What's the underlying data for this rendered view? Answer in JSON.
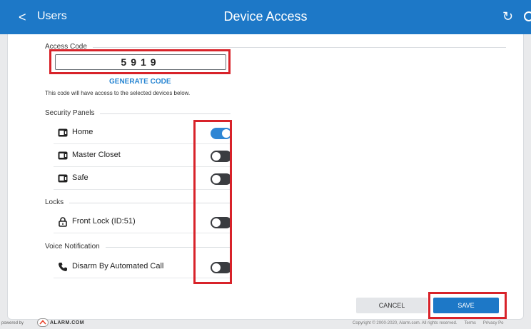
{
  "header": {
    "back_glyph": "<",
    "back_label": "Users",
    "title": "Device Access",
    "refresh_icon": "refresh-icon"
  },
  "access_code": {
    "section_label": "Access Code",
    "value": "5919",
    "generate_label": "GENERATE CODE",
    "help_text": "This code will have access to the selected devices below."
  },
  "security_panels": {
    "section_label": "Security Panels",
    "items": [
      {
        "label": "Home",
        "enabled": true
      },
      {
        "label": "Master Closet",
        "enabled": false
      },
      {
        "label": "Safe",
        "enabled": false
      }
    ]
  },
  "locks": {
    "section_label": "Locks",
    "items": [
      {
        "label": "Front Lock (ID:51)",
        "enabled": false
      }
    ]
  },
  "voice_notification": {
    "section_label": "Voice Notification",
    "items": [
      {
        "label": "Disarm By Automated Call",
        "enabled": false
      }
    ]
  },
  "actions": {
    "cancel_label": "CANCEL",
    "save_label": "SAVE"
  },
  "footer": {
    "powered_by": "powered by",
    "brand": "ALARM.COM",
    "copyright": "Copyright © 2000-2020, Alarm.com. All rights reserved.",
    "terms": "Terms",
    "privacy": "Privacy Po"
  },
  "colors": {
    "header_blue": "#1d78c7",
    "toggle_on": "#2f86d4",
    "highlight_red": "#d8232a"
  }
}
